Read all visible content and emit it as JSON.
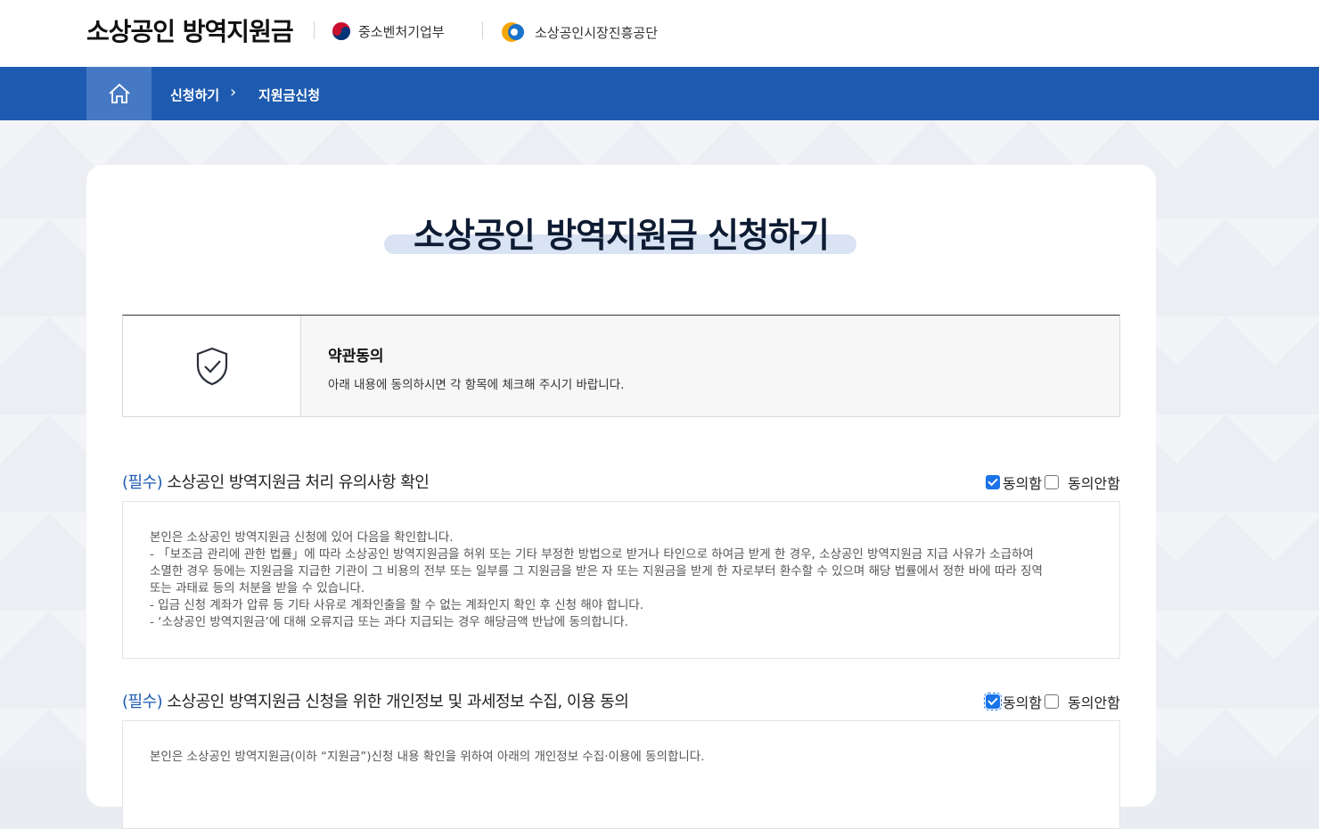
{
  "header": {
    "site_title": "소상공인 방역지원금",
    "org1": "중소벤처기업부",
    "org2": "소상공인시장진흥공단"
  },
  "nav": {
    "crumb1": "신청하기",
    "crumb_sep": "›",
    "crumb2": "지원금신청"
  },
  "page": {
    "title": "소상공인 방역지원금 신청하기"
  },
  "terms": {
    "heading": "약관동의",
    "description": "아래 내용에 동의하시면 각 항목에 체크해 주시기 바랍니다."
  },
  "sections": [
    {
      "required_tag": "(필수)",
      "title": "소상공인 방역지원금 처리 유의사항 확인",
      "agree_label": "동의함",
      "disagree_label": "동의안함",
      "agree_checked": true,
      "lines": [
        "본인은 소상공인 방역지원금 신청에 있어 다음을 확인합니다.",
        "- 「보조금 관리에 관한 법률」에 따라 소상공인 방역지원금을 허위 또는 기타 부정한 방법으로 받거나 타인으로 하여금 받게 한 경우, 소상공인 방역지원금 지급 사유가 소급하여",
        "소멸한 경우 등에는 지원금을 지급한 기관이 그 비용의 전부 또는 일부를 그 지원금을 받은 자 또는 지원금을 받게 한 자로부터 환수할 수 있으며 해당 법률에서 정한 바에 따라 징역",
        "또는 과태료 등의 처분을 받을 수 있습니다.",
        "- 입금 신청 계좌가 압류 등 기타 사유로 계좌인출을 할 수 없는 계좌인지 확인 후 신청 해야 합니다.",
        "- ‘소상공인 방역지원금’에 대해 오류지급 또는 과다 지급되는 경우 해당금액 반납에 동의합니다."
      ]
    },
    {
      "required_tag": "(필수)",
      "title": "소상공인 방역지원금 신청을 위한 개인정보 및 과세정보 수집, 이용 동의",
      "agree_label": "동의함",
      "disagree_label": "동의안함",
      "agree_checked": true,
      "lines": [
        "본인은 소상공인 방역지원금(이하 “지원금”)신청 내용 확인을 위하여 아래의 개인정보 수집·이용에 동의합니다."
      ]
    }
  ],
  "colors": {
    "nav_blue": "#1e5bb0",
    "home_blue": "#4679c4",
    "required_blue": "#1e5bb0"
  }
}
